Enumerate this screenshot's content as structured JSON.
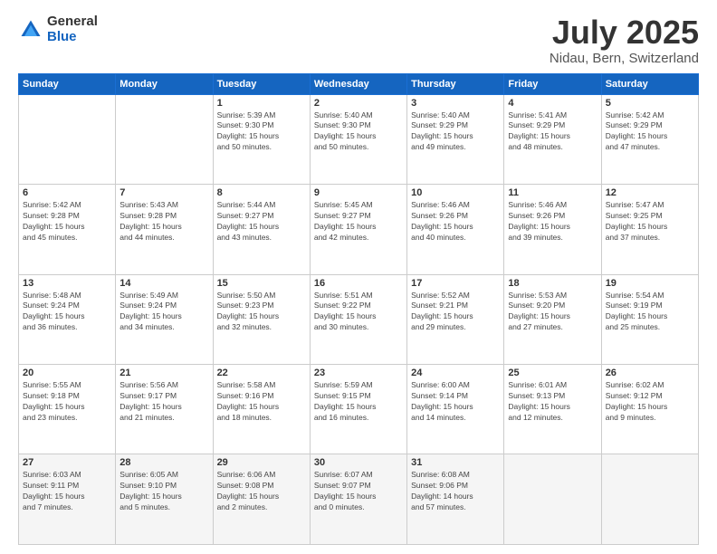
{
  "logo": {
    "general": "General",
    "blue": "Blue"
  },
  "title": "July 2025",
  "subtitle": "Nidau, Bern, Switzerland",
  "headers": [
    "Sunday",
    "Monday",
    "Tuesday",
    "Wednesday",
    "Thursday",
    "Friday",
    "Saturday"
  ],
  "weeks": [
    [
      {
        "day": "",
        "info": ""
      },
      {
        "day": "",
        "info": ""
      },
      {
        "day": "1",
        "info": "Sunrise: 5:39 AM\nSunset: 9:30 PM\nDaylight: 15 hours\nand 50 minutes."
      },
      {
        "day": "2",
        "info": "Sunrise: 5:40 AM\nSunset: 9:30 PM\nDaylight: 15 hours\nand 50 minutes."
      },
      {
        "day": "3",
        "info": "Sunrise: 5:40 AM\nSunset: 9:29 PM\nDaylight: 15 hours\nand 49 minutes."
      },
      {
        "day": "4",
        "info": "Sunrise: 5:41 AM\nSunset: 9:29 PM\nDaylight: 15 hours\nand 48 minutes."
      },
      {
        "day": "5",
        "info": "Sunrise: 5:42 AM\nSunset: 9:29 PM\nDaylight: 15 hours\nand 47 minutes."
      }
    ],
    [
      {
        "day": "6",
        "info": "Sunrise: 5:42 AM\nSunset: 9:28 PM\nDaylight: 15 hours\nand 45 minutes."
      },
      {
        "day": "7",
        "info": "Sunrise: 5:43 AM\nSunset: 9:28 PM\nDaylight: 15 hours\nand 44 minutes."
      },
      {
        "day": "8",
        "info": "Sunrise: 5:44 AM\nSunset: 9:27 PM\nDaylight: 15 hours\nand 43 minutes."
      },
      {
        "day": "9",
        "info": "Sunrise: 5:45 AM\nSunset: 9:27 PM\nDaylight: 15 hours\nand 42 minutes."
      },
      {
        "day": "10",
        "info": "Sunrise: 5:46 AM\nSunset: 9:26 PM\nDaylight: 15 hours\nand 40 minutes."
      },
      {
        "day": "11",
        "info": "Sunrise: 5:46 AM\nSunset: 9:26 PM\nDaylight: 15 hours\nand 39 minutes."
      },
      {
        "day": "12",
        "info": "Sunrise: 5:47 AM\nSunset: 9:25 PM\nDaylight: 15 hours\nand 37 minutes."
      }
    ],
    [
      {
        "day": "13",
        "info": "Sunrise: 5:48 AM\nSunset: 9:24 PM\nDaylight: 15 hours\nand 36 minutes."
      },
      {
        "day": "14",
        "info": "Sunrise: 5:49 AM\nSunset: 9:24 PM\nDaylight: 15 hours\nand 34 minutes."
      },
      {
        "day": "15",
        "info": "Sunrise: 5:50 AM\nSunset: 9:23 PM\nDaylight: 15 hours\nand 32 minutes."
      },
      {
        "day": "16",
        "info": "Sunrise: 5:51 AM\nSunset: 9:22 PM\nDaylight: 15 hours\nand 30 minutes."
      },
      {
        "day": "17",
        "info": "Sunrise: 5:52 AM\nSunset: 9:21 PM\nDaylight: 15 hours\nand 29 minutes."
      },
      {
        "day": "18",
        "info": "Sunrise: 5:53 AM\nSunset: 9:20 PM\nDaylight: 15 hours\nand 27 minutes."
      },
      {
        "day": "19",
        "info": "Sunrise: 5:54 AM\nSunset: 9:19 PM\nDaylight: 15 hours\nand 25 minutes."
      }
    ],
    [
      {
        "day": "20",
        "info": "Sunrise: 5:55 AM\nSunset: 9:18 PM\nDaylight: 15 hours\nand 23 minutes."
      },
      {
        "day": "21",
        "info": "Sunrise: 5:56 AM\nSunset: 9:17 PM\nDaylight: 15 hours\nand 21 minutes."
      },
      {
        "day": "22",
        "info": "Sunrise: 5:58 AM\nSunset: 9:16 PM\nDaylight: 15 hours\nand 18 minutes."
      },
      {
        "day": "23",
        "info": "Sunrise: 5:59 AM\nSunset: 9:15 PM\nDaylight: 15 hours\nand 16 minutes."
      },
      {
        "day": "24",
        "info": "Sunrise: 6:00 AM\nSunset: 9:14 PM\nDaylight: 15 hours\nand 14 minutes."
      },
      {
        "day": "25",
        "info": "Sunrise: 6:01 AM\nSunset: 9:13 PM\nDaylight: 15 hours\nand 12 minutes."
      },
      {
        "day": "26",
        "info": "Sunrise: 6:02 AM\nSunset: 9:12 PM\nDaylight: 15 hours\nand 9 minutes."
      }
    ],
    [
      {
        "day": "27",
        "info": "Sunrise: 6:03 AM\nSunset: 9:11 PM\nDaylight: 15 hours\nand 7 minutes."
      },
      {
        "day": "28",
        "info": "Sunrise: 6:05 AM\nSunset: 9:10 PM\nDaylight: 15 hours\nand 5 minutes."
      },
      {
        "day": "29",
        "info": "Sunrise: 6:06 AM\nSunset: 9:08 PM\nDaylight: 15 hours\nand 2 minutes."
      },
      {
        "day": "30",
        "info": "Sunrise: 6:07 AM\nSunset: 9:07 PM\nDaylight: 15 hours\nand 0 minutes."
      },
      {
        "day": "31",
        "info": "Sunrise: 6:08 AM\nSunset: 9:06 PM\nDaylight: 14 hours\nand 57 minutes."
      },
      {
        "day": "",
        "info": ""
      },
      {
        "day": "",
        "info": ""
      }
    ]
  ]
}
